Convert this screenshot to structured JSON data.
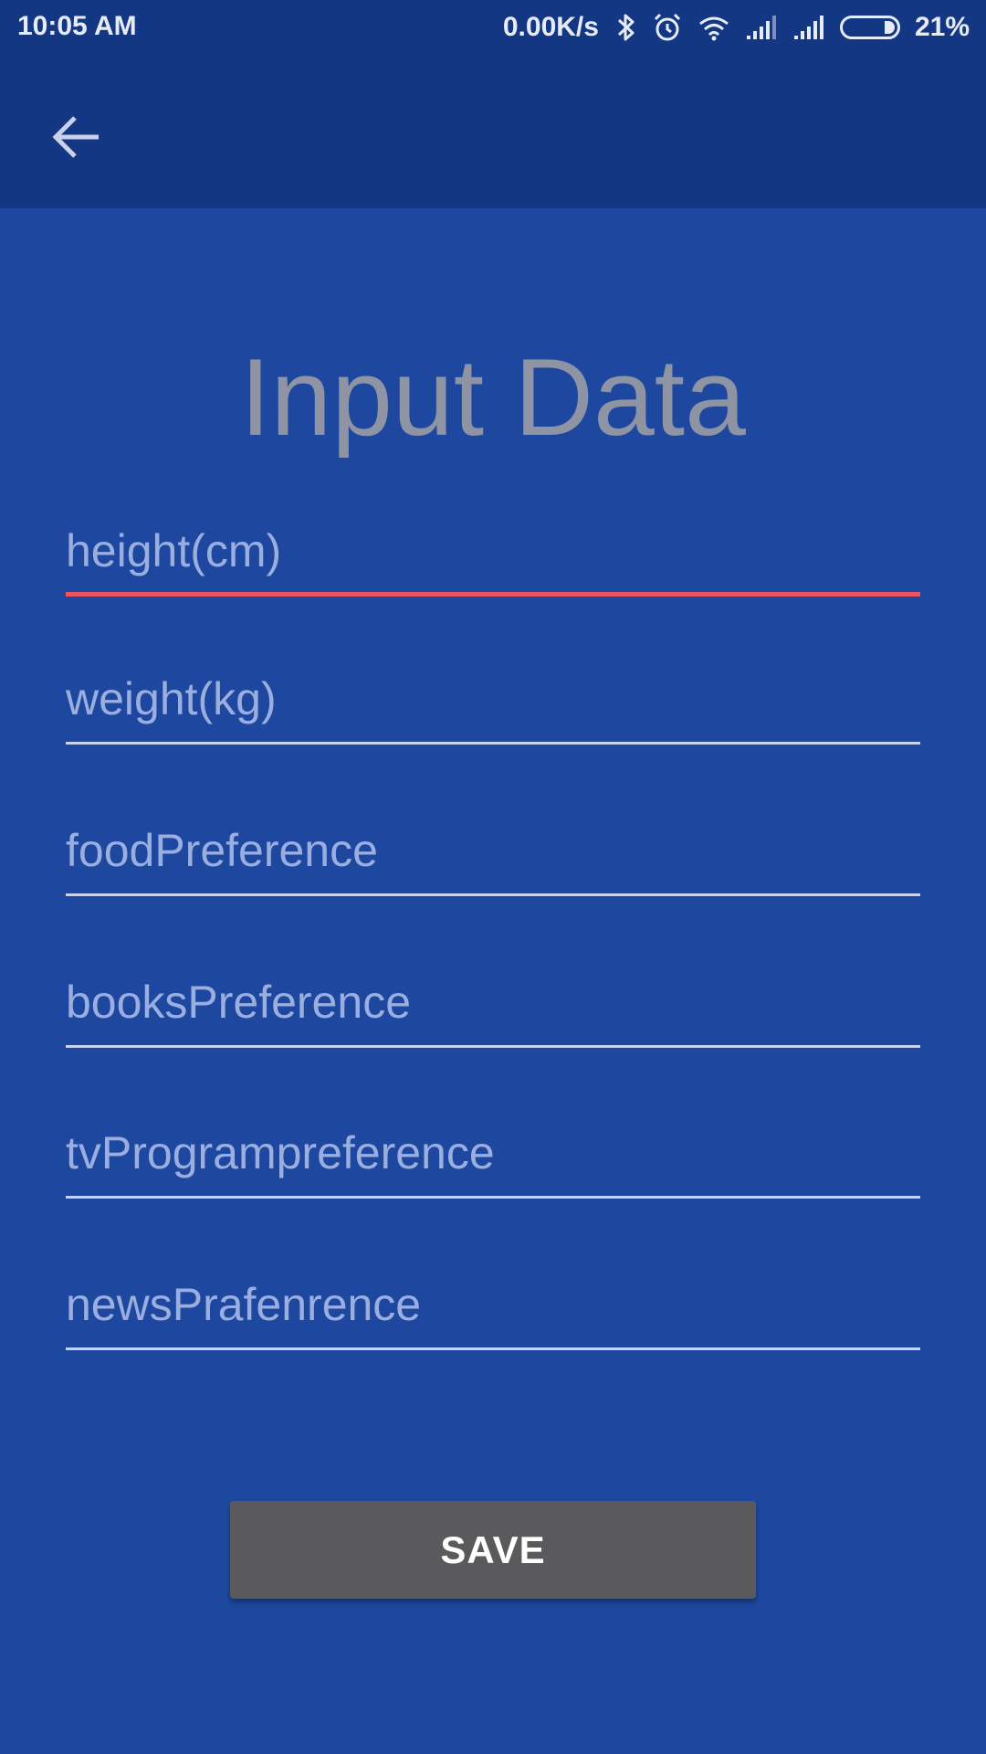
{
  "status_bar": {
    "time": "10:05 AM",
    "network_speed": "0.00K/s",
    "battery_percent": "21%",
    "battery_level": 0.21,
    "icons": [
      "bluetooth-icon",
      "alarm-icon",
      "wifi-icon",
      "signal-icon",
      "signal-icon",
      "battery-icon"
    ]
  },
  "app_bar": {
    "back_icon": "arrow-left-icon"
  },
  "main": {
    "title": "Input Data",
    "fields": [
      {
        "placeholder": "height(cm)",
        "value": "",
        "focused": true
      },
      {
        "placeholder": "weight(kg)",
        "value": ""
      },
      {
        "placeholder": "foodPreference",
        "value": ""
      },
      {
        "placeholder": "booksPreference",
        "value": ""
      },
      {
        "placeholder": "tvProgrampreference",
        "value": ""
      },
      {
        "placeholder": "newsPrafenrence",
        "value": ""
      }
    ],
    "save_label": "SAVE"
  },
  "colors": {
    "background": "#1e48a0",
    "app_bar": "#143784",
    "focus_underline": "#e9545e",
    "title_text": "#8f94a4",
    "save_button": "#5a5a5c"
  }
}
